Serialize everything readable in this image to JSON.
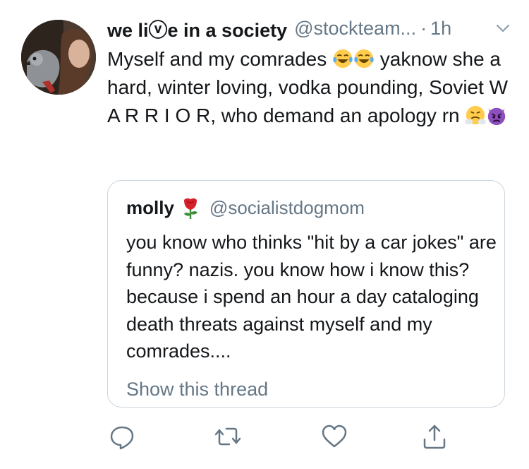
{
  "tweet": {
    "display_name": "we liⓥe in a society",
    "handle": "@stockteam...",
    "time_separator": "·",
    "time": "1h",
    "text_part1": "Myself and my comrades",
    "text_part2": "yaknow she a hard, winter loving, vodka pounding, Soviet W A R R I O R, who demand an apology rn"
  },
  "quote": {
    "display_name": "molly",
    "handle": "@socialistdogmom",
    "text": "you know who thinks \"hit by a car jokes\" are funny? nazis. you know how i know this? because i spend an hour a day cataloging death threats against myself and my comrades....",
    "link": "Show this thread"
  },
  "icons": {
    "more": "chevron-down-icon",
    "emoji_laugh": "tears-of-joy-emoji",
    "emoji_steam": "face-with-steam-emoji",
    "emoji_devil": "angry-devil-emoji",
    "emoji_rose": "rose-emoji",
    "reply": "reply-icon",
    "retweet": "retweet-icon",
    "like": "heart-icon",
    "share": "share-icon"
  },
  "colors": {
    "text": "#14171a",
    "secondary": "#657786",
    "border": "#ccd6dd"
  }
}
